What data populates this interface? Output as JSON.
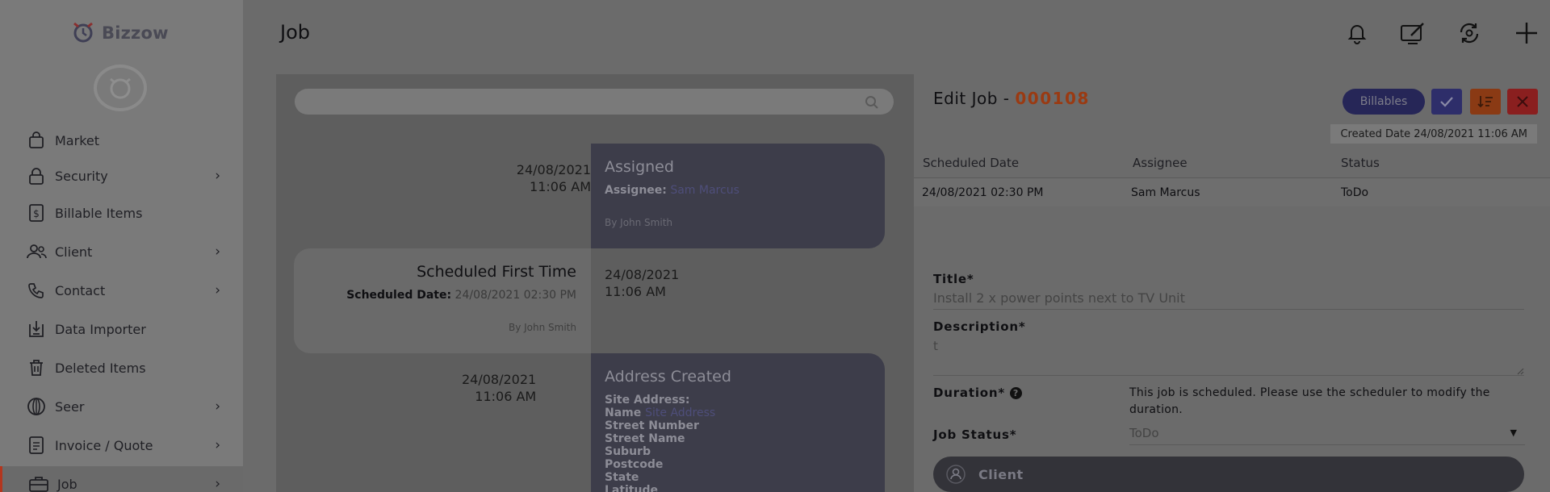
{
  "app": {
    "brand": "Bizzow"
  },
  "sidebar": {
    "items": [
      {
        "label": "Market",
        "icon": "bag-icon",
        "chevron": false
      },
      {
        "label": "Security",
        "icon": "lock-icon",
        "chevron": true
      },
      {
        "label": "Billable Items",
        "icon": "dollar-icon",
        "chevron": false
      },
      {
        "label": "Client",
        "icon": "users-icon",
        "chevron": true
      },
      {
        "label": "Contact",
        "icon": "phone-icon",
        "chevron": true
      },
      {
        "label": "Data Importer",
        "icon": "import-icon",
        "chevron": false
      },
      {
        "label": "Deleted Items",
        "icon": "trash-icon",
        "chevron": false
      },
      {
        "label": "Seer",
        "icon": "globe-icon",
        "chevron": true
      },
      {
        "label": "Invoice / Quote",
        "icon": "document-icon",
        "chevron": true
      },
      {
        "label": "Job",
        "icon": "briefcase-icon",
        "chevron": true
      }
    ],
    "chevron": "›"
  },
  "header": {
    "title": "Job"
  },
  "timeline": {
    "search_placeholder": "",
    "events": [
      {
        "date": "24/08/2021",
        "time": "11:06 AM",
        "title": "Assigned",
        "detail_label": "Assignee:",
        "detail_value": "Sam Marcus",
        "by": "By John Smith"
      },
      {
        "date": "24/08/2021",
        "time": "11:06 AM",
        "title": "Scheduled First Time",
        "detail_label": "Scheduled Date:",
        "detail_value": "24/08/2021 02:30 PM",
        "by": "By John Smith"
      },
      {
        "date": "24/08/2021",
        "time": "11:06 AM",
        "title": "Address Created",
        "lines": [
          "Site Address:",
          "Name",
          "Street Number",
          "Street Name",
          "Suburb",
          "Postcode",
          "State",
          "Latitude"
        ],
        "name_value": "Site Address"
      }
    ]
  },
  "edit": {
    "title_prefix": "Edit Job - ",
    "job_number": "000108",
    "billables_label": "Billables",
    "created": "Created Date 24/08/2021 11:06 AM",
    "table": {
      "headers": [
        "Scheduled Date",
        "Assignee",
        "Status"
      ],
      "row": [
        "24/08/2021 02:30 PM",
        "Sam Marcus",
        "ToDo"
      ]
    },
    "fields": {
      "title_label": "Title*",
      "title_value": "Install 2 x power points next to TV Unit",
      "description_label": "Description*",
      "description_value": "t",
      "duration_label": "Duration*",
      "duration_note": "This job is scheduled. Please use the scheduler to modify the duration.",
      "status_label": "Job Status*",
      "status_value": "ToDo"
    },
    "client_label": "Client"
  },
  "colors": {
    "overlay_bg": "#6b6b6b",
    "accent_dark": "#262657",
    "job_number": "#9a3a12",
    "card_dark": "#3d3d4a",
    "confirm": "#2e2e6a",
    "sort": "#8a3a14",
    "close": "#8a1f1f"
  }
}
